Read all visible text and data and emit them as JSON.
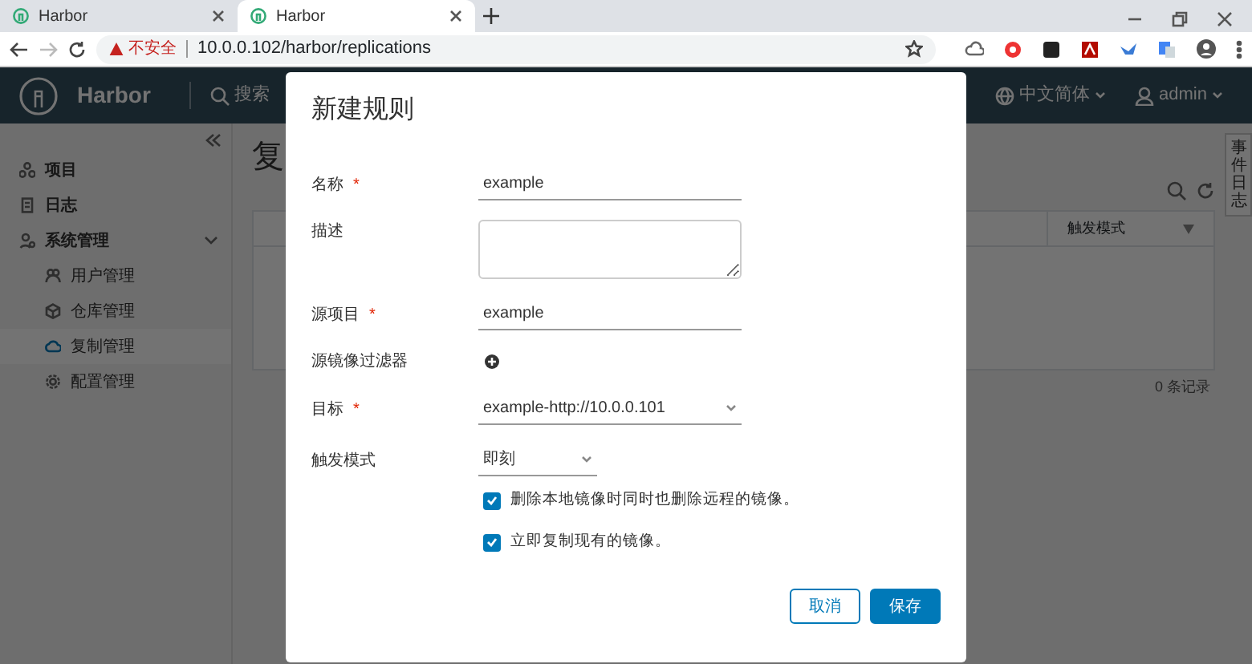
{
  "browser": {
    "tabs": [
      {
        "title": "Harbor",
        "selected": false
      },
      {
        "title": "Harbor",
        "selected": true
      }
    ],
    "address": {
      "security_label": "不安全",
      "url": "10.0.0.102/harbor/replications"
    }
  },
  "app": {
    "header": {
      "brand": "Harbor",
      "search": "搜索",
      "language": "中文简体",
      "user": "admin"
    },
    "sidebar": [
      {
        "label": "项目",
        "selected": false
      },
      {
        "label": "日志",
        "selected": false
      },
      {
        "label": "系统管理",
        "selected": false,
        "expanded": true,
        "children": [
          {
            "label": "用户管理",
            "selected": false
          },
          {
            "label": "仓库管理",
            "selected": false
          },
          {
            "label": "复制管理",
            "selected": true
          },
          {
            "label": "配置管理",
            "selected": false
          }
        ]
      }
    ],
    "page_title": "复",
    "table": {
      "columns": [
        "触发模式"
      ],
      "footer": "0 条记录"
    },
    "side_tab": "事件日志"
  },
  "dialog": {
    "title": "新建规则",
    "fields": [
      {
        "label": "名称",
        "required_mark": "*",
        "kind": "text",
        "value": "example"
      },
      {
        "label": "描述",
        "kind": "textarea"
      },
      {
        "label": "源项目",
        "required_mark": "*",
        "kind": "text",
        "value": "example"
      },
      {
        "label": "源镜像过滤器",
        "kind": "add"
      },
      {
        "label": "目标",
        "required_mark": "*",
        "kind": "select",
        "value": "example-http://10.0.0.101"
      },
      {
        "label": "触发模式",
        "kind": "select_small",
        "value": "即刻"
      }
    ],
    "checkboxes": [
      {
        "label": "删除本地镜像时同时也删除远程的镜像。",
        "checked": true
      },
      {
        "label": "立即复制现有的镜像。",
        "checked": true
      }
    ],
    "buttons": [
      {
        "label": "取消",
        "kind": "secondary"
      },
      {
        "label": "保存",
        "kind": "primary"
      }
    ]
  }
}
